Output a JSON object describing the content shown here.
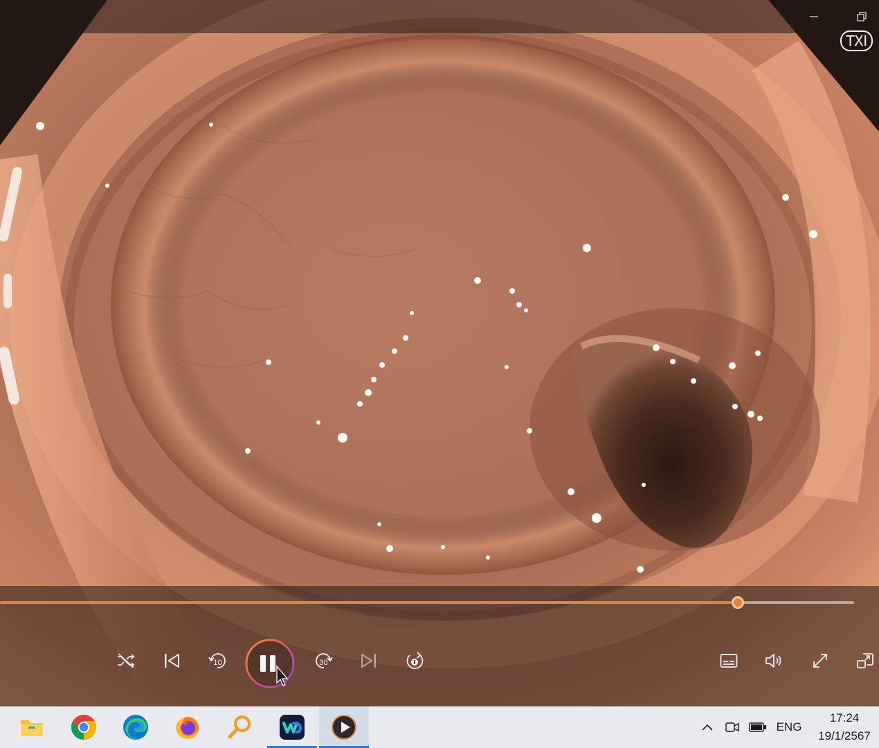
{
  "window": {
    "badge": "TXI",
    "controls": {
      "minimize_icon": "minimize-icon",
      "restore_icon": "restore-icon"
    }
  },
  "player": {
    "progress_fraction": 0.864,
    "accent_color": "#e8822e",
    "buttons": [
      "shuffle-icon",
      "previous-icon",
      "rewind-10-icon",
      "pause-icon",
      "forward-30-icon",
      "next-icon",
      "repeat-one-icon",
      "subtitles-icon",
      "volume-icon",
      "fullscreen-icon",
      "miniplayer-icon"
    ],
    "rewind_label": "10",
    "forward_label": "30",
    "state": "playing"
  },
  "taskbar": {
    "apps": [
      "File Explorer",
      "Google Chrome",
      "Microsoft Edge",
      "Firefox",
      "Search",
      "Webex",
      "Media Player"
    ],
    "active_app": "Media Player",
    "tray": {
      "language": "ENG",
      "time": "17:24",
      "date": "19/1/2567"
    }
  }
}
